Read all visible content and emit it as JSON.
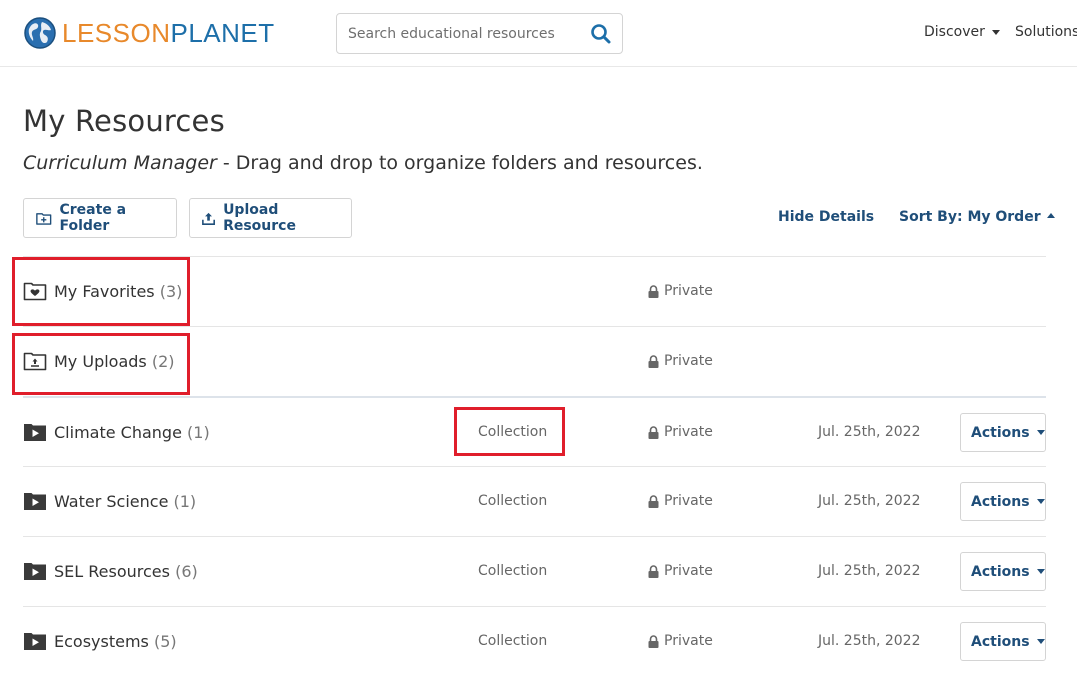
{
  "header": {
    "logo_part1": "LESSON",
    "logo_part2": "PLANET",
    "search_placeholder": "Search educational resources",
    "nav": [
      {
        "label": "Discover"
      },
      {
        "label": "Solutions"
      }
    ]
  },
  "page": {
    "title": "My Resources",
    "subtitle_em": "Curriculum Manager",
    "subtitle_rest": " - Drag and drop to organize folders and resources."
  },
  "toolbar": {
    "create_folder": "Create a Folder",
    "upload_resource": "Upload Resource",
    "hide_details": "Hide Details",
    "sort_by": "Sort By: My Order"
  },
  "rows": [
    {
      "icon": "heart-folder-icon",
      "name": "My Favorites",
      "count": "(3)",
      "type": "",
      "privacy": "Private",
      "date": "",
      "actions": ""
    },
    {
      "icon": "upload-folder-icon",
      "name": "My Uploads",
      "count": "(2)",
      "type": "",
      "privacy": "Private",
      "date": "",
      "actions": ""
    },
    {
      "icon": "play-folder-icon",
      "name": "Climate Change",
      "count": "(1)",
      "type": "Collection",
      "privacy": "Private",
      "date": "Jul. 25th, 2022",
      "actions": "Actions"
    },
    {
      "icon": "play-folder-icon",
      "name": "Water Science",
      "count": "(1)",
      "type": "Collection",
      "privacy": "Private",
      "date": "Jul. 25th, 2022",
      "actions": "Actions"
    },
    {
      "icon": "play-folder-icon",
      "name": "SEL Resources",
      "count": "(6)",
      "type": "Collection",
      "privacy": "Private",
      "date": "Jul. 25th, 2022",
      "actions": "Actions"
    },
    {
      "icon": "play-folder-icon",
      "name": "Ecosystems",
      "count": "(5)",
      "type": "Collection",
      "privacy": "Private",
      "date": "Jul. 25th, 2022",
      "actions": "Actions"
    }
  ],
  "colors": {
    "brand_orange": "#e8892b",
    "brand_blue": "#1d6fa9",
    "link_blue": "#1f4e79",
    "highlight_red": "#e01e2b"
  }
}
